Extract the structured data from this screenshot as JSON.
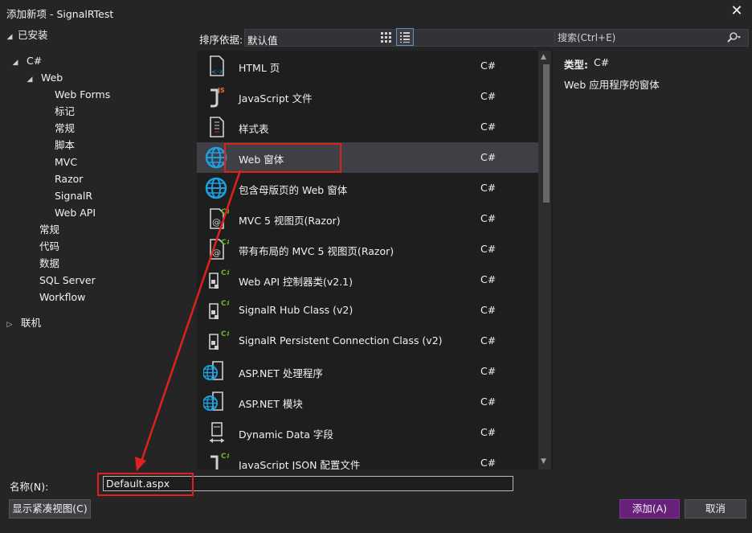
{
  "window": {
    "title": "添加新项 - SignalRTest",
    "close": "✕"
  },
  "tree": {
    "installed": "已安装",
    "csharp": "C#",
    "web": "Web",
    "web_children": [
      "Web Forms",
      "标记",
      "常规",
      "脚本",
      "MVC",
      "Razor",
      "SignalR",
      "Web API"
    ],
    "csharp_children": [
      "常规",
      "代码",
      "数据",
      "SQL Server",
      "Workflow"
    ],
    "online": "联机"
  },
  "toolbar": {
    "sort_label": "排序依据:",
    "sort_value": "默认值"
  },
  "templates": [
    {
      "name": "HTML 页",
      "lang": "C#",
      "icon": "html-file-icon"
    },
    {
      "name": "JavaScript 文件",
      "lang": "C#",
      "icon": "javascript-file-icon"
    },
    {
      "name": "样式表",
      "lang": "C#",
      "icon": "stylesheet-icon"
    },
    {
      "name": "Web 窗体",
      "lang": "C#",
      "icon": "globe-icon"
    },
    {
      "name": "包含母版页的 Web 窗体",
      "lang": "C#",
      "icon": "globe-icon"
    },
    {
      "name": "MVC 5 视图页(Razor)",
      "lang": "C#",
      "icon": "razor-view-icon"
    },
    {
      "name": "带有布局的 MVC 5 视图页(Razor)",
      "lang": "C#",
      "icon": "razor-view-icon"
    },
    {
      "name": "Web API 控制器类(v2.1)",
      "lang": "C#",
      "icon": "csharp-class-icon"
    },
    {
      "name": "SignalR Hub Class (v2)",
      "lang": "C#",
      "icon": "csharp-class-icon"
    },
    {
      "name": "SignalR Persistent Connection Class (v2)",
      "lang": "C#",
      "icon": "csharp-class-icon"
    },
    {
      "name": "ASP.NET 处理程序",
      "lang": "C#",
      "icon": "globe-file-icon"
    },
    {
      "name": "ASP.NET 模块",
      "lang": "C#",
      "icon": "globe-file-icon"
    },
    {
      "name": "Dynamic Data 字段",
      "lang": "C#",
      "icon": "dynamic-data-icon"
    },
    {
      "name": "JavaScript JSON 配置文件",
      "lang": "C#",
      "icon": "json-file-icon"
    }
  ],
  "selected_index": 3,
  "search": {
    "placeholder": "搜索(Ctrl+E)"
  },
  "details": {
    "type_label": "类型:",
    "type_value": "C#",
    "description": "Web 应用程序的窗体"
  },
  "bottom": {
    "name_label": "名称(N):",
    "name_value": "Default.aspx",
    "compact_view": "显示紧凑视图(C)",
    "add": "添加(A)",
    "cancel": "取消"
  },
  "colors": {
    "accent": "#68217a",
    "annotation": "#e0201e",
    "globe": "#1ba1e2",
    "csharp_badge": "#68b723"
  }
}
